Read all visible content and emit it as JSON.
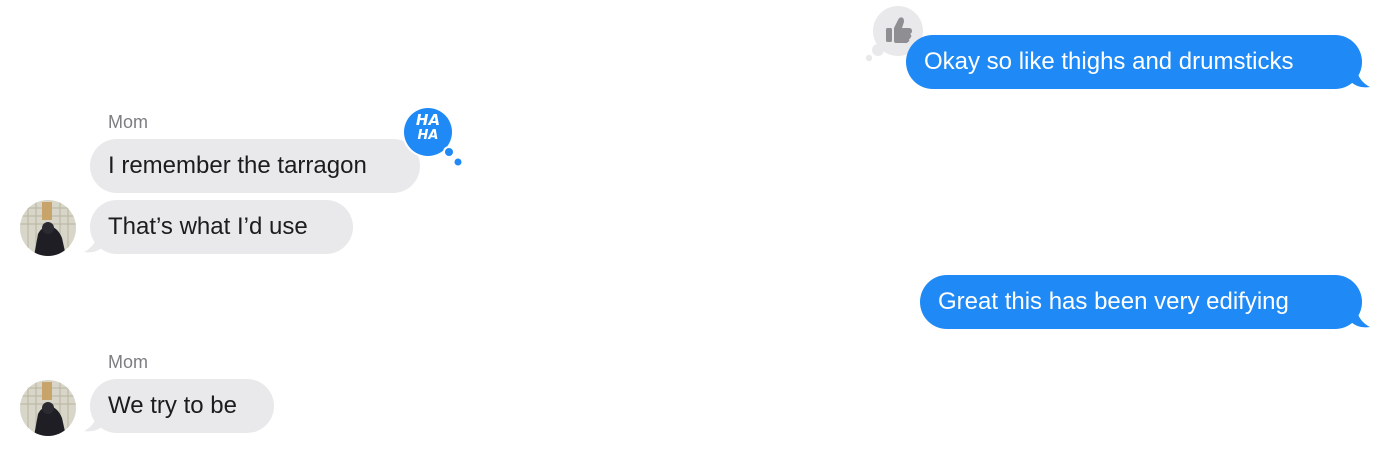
{
  "colors": {
    "outgoing_bubble": "#1f8af6",
    "incoming_bubble": "#e9e9eb",
    "sender_label": "#7d7d82",
    "tapback_gray": "#e9e9eb",
    "tapback_blue": "#1f8af6"
  },
  "messages": [
    {
      "direction": "outgoing",
      "text": "Okay so like thighs and drumsticks",
      "tapback": "thumbs-up"
    },
    {
      "direction": "incoming",
      "sender": "Mom",
      "text": "I remember the tarragon",
      "tapback": "haha"
    },
    {
      "direction": "incoming",
      "text": "That’s what I’d use",
      "avatar": true
    },
    {
      "direction": "outgoing",
      "text": "Great this has been very edifying"
    },
    {
      "direction": "incoming",
      "sender": "Mom",
      "text": "We try to be",
      "avatar": true
    }
  ],
  "tapbacks": {
    "haha": {
      "line1": "HA",
      "line2": "HA"
    }
  }
}
